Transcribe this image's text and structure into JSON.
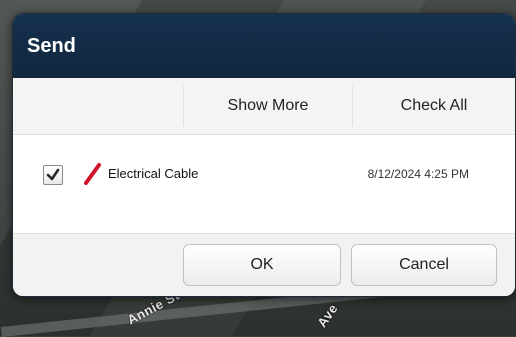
{
  "background": {
    "street_labels": [
      "Annie St",
      "Ave"
    ]
  },
  "dialog": {
    "title": "Send",
    "toolbar": {
      "show_more": "Show More",
      "check_all": "Check All"
    },
    "items": [
      {
        "checked": true,
        "icon": "red-line-icon",
        "name": "Electrical Cable",
        "date": "8/12/2024 4:25 PM"
      }
    ],
    "buttons": {
      "ok": "OK",
      "cancel": "Cancel"
    }
  },
  "colors": {
    "title_bar": "#16314d",
    "accent_border": "#1f2c3b",
    "cable_red": "#d0152b"
  }
}
